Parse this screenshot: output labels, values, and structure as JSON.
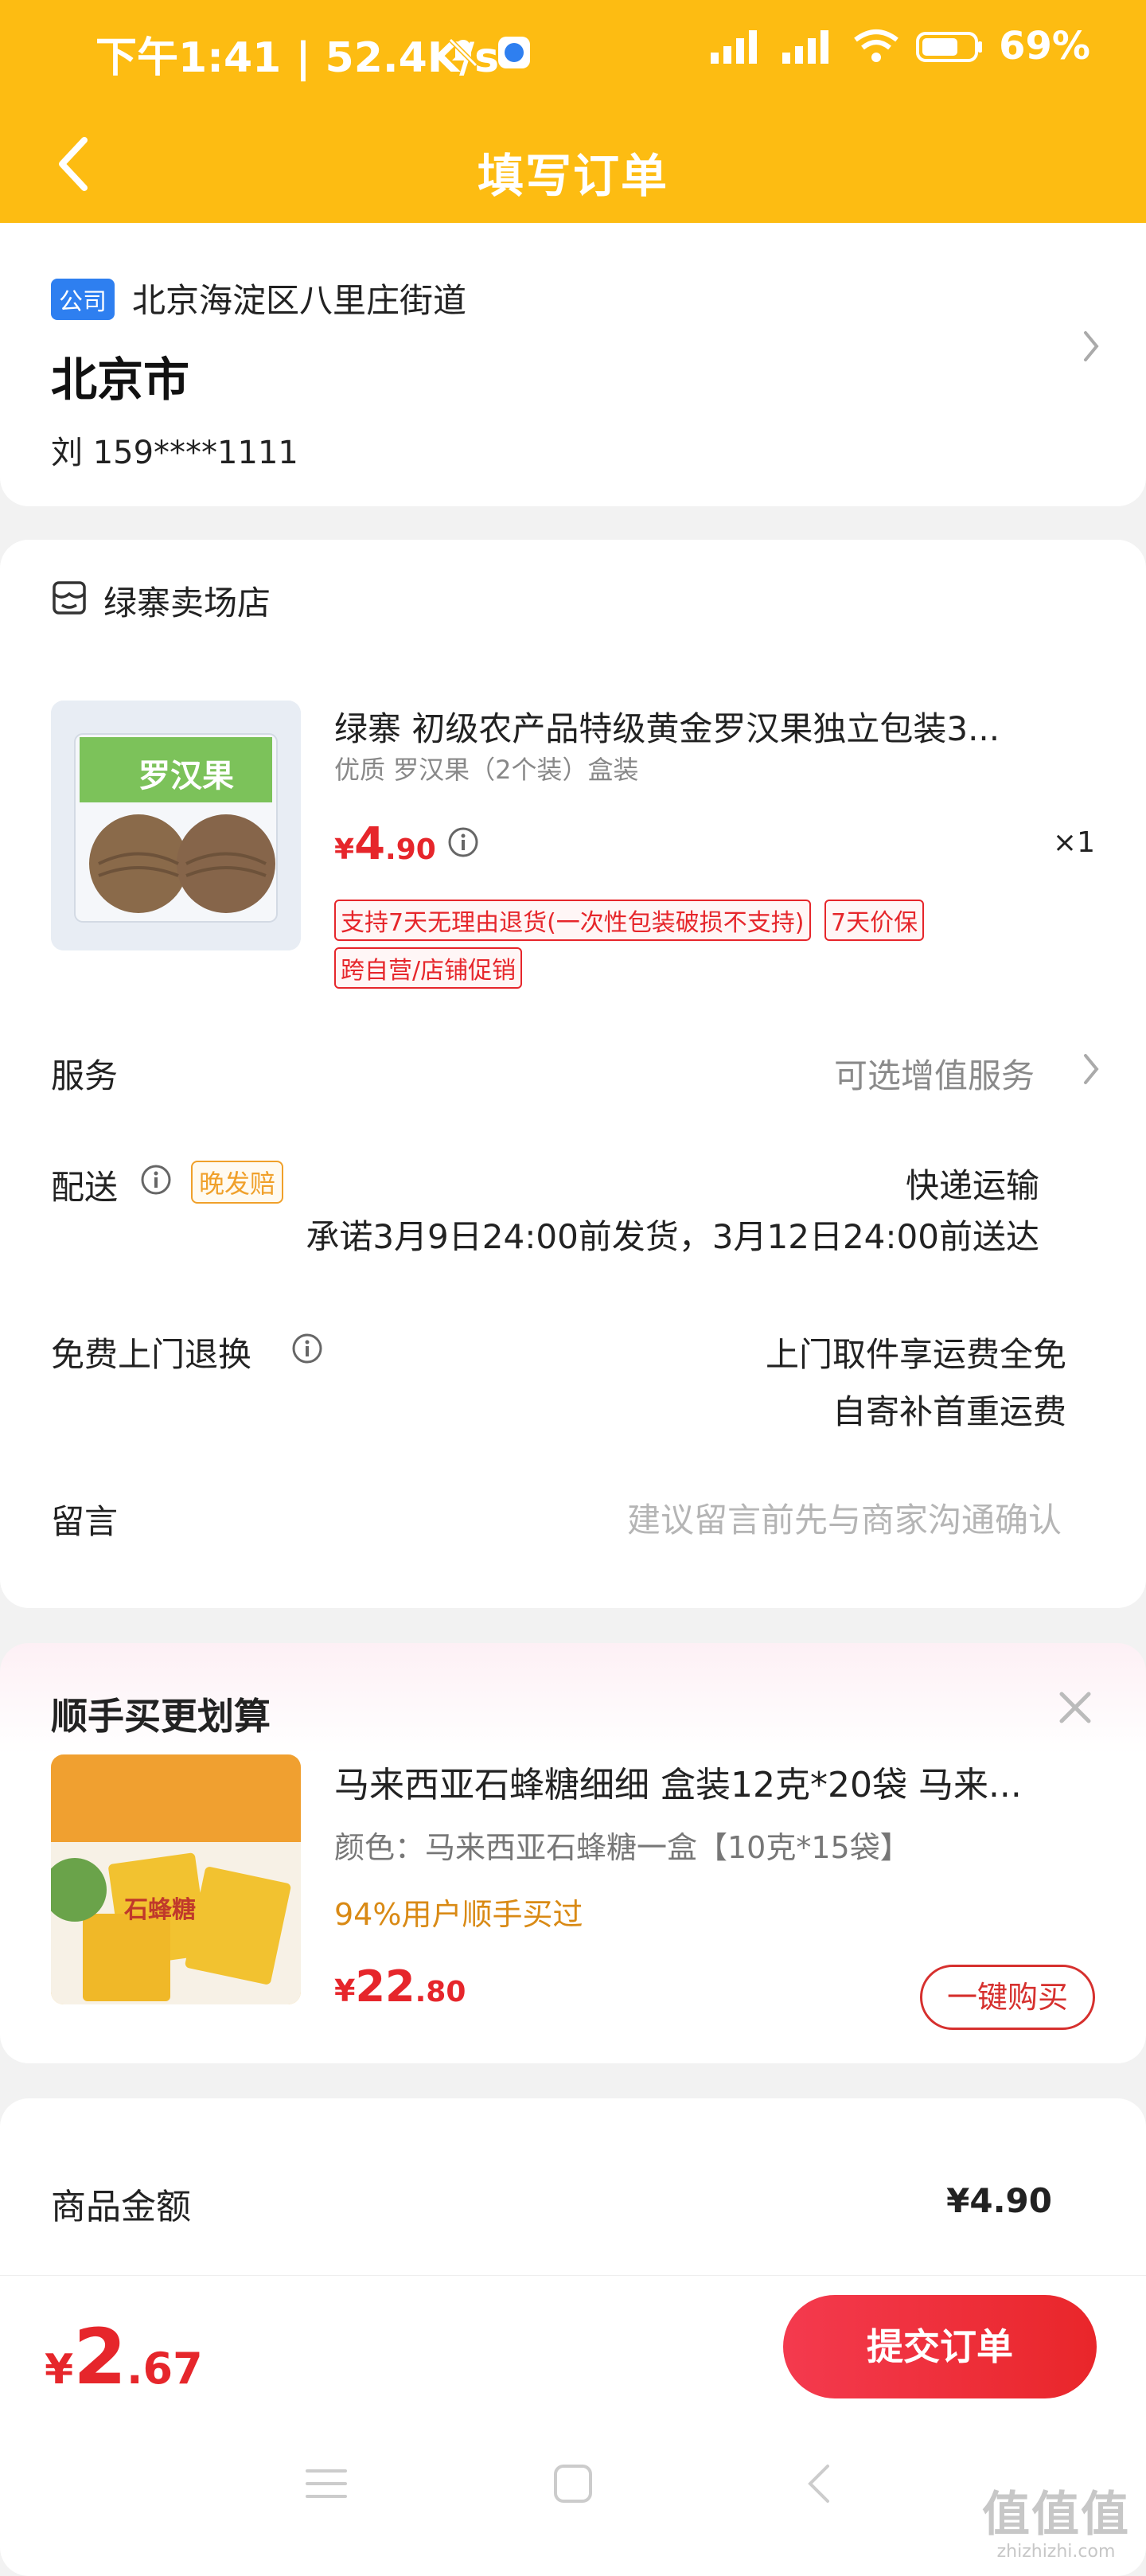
{
  "status_bar": {
    "time": "下午1:41 | 52.4K/s",
    "battery": "69%"
  },
  "nav": {
    "title": "填写订单"
  },
  "address": {
    "tag": "公司",
    "line": "北京海淀区八里庄街道",
    "city": "北京市",
    "person": "刘  159****1111"
  },
  "shop": {
    "name": "绿寨卖场店",
    "product": {
      "image_label": "罗汉果",
      "title": "绿寨 初级农产品特级黄金罗汉果独立包装3...",
      "spec": "优质 罗汉果（2个装）盒装",
      "price_symbol": "¥",
      "price_int": "4",
      "price_dec": ".90",
      "qty": "×1",
      "badges": [
        "支持7天无理由退货(一次性包装破损不支持)",
        "7天价保",
        "跨自营/店铺促销"
      ]
    },
    "service": {
      "label": "服务",
      "value": "可选增值服务"
    },
    "delivery": {
      "label": "配送",
      "badge": "晚发赔",
      "method": "快递运输",
      "promise": "承诺3月9日24:00前发货，3月12日24:00前送达"
    },
    "returns": {
      "label": "免费上门退换",
      "line1": "上门取件享运费全免",
      "line2": "自寄补首重运费"
    },
    "message": {
      "label": "留言",
      "placeholder": "建议留言前先与商家沟通确认"
    }
  },
  "upsell": {
    "title": "顺手买更划算",
    "image_label": "石蜂糖",
    "name": "马来西亚石蜂糖细细 盒装12克*20袋 马来...",
    "color": "颜色：马来西亚石蜂糖一盒【10克*15袋】",
    "bought": "94%用户顺手买过",
    "price_symbol": "¥",
    "price_int": "22",
    "price_dec": ".80",
    "buy_label": "一键购买"
  },
  "summary": {
    "goods_label": "商品金额",
    "goods_value": "¥4.90"
  },
  "bottom": {
    "total_symbol": "¥",
    "total_int": "2",
    "total_dec": ".67",
    "submit_label": "提交订单"
  },
  "watermark": {
    "main": "值值值",
    "sub": "zhizhizhi.com"
  }
}
